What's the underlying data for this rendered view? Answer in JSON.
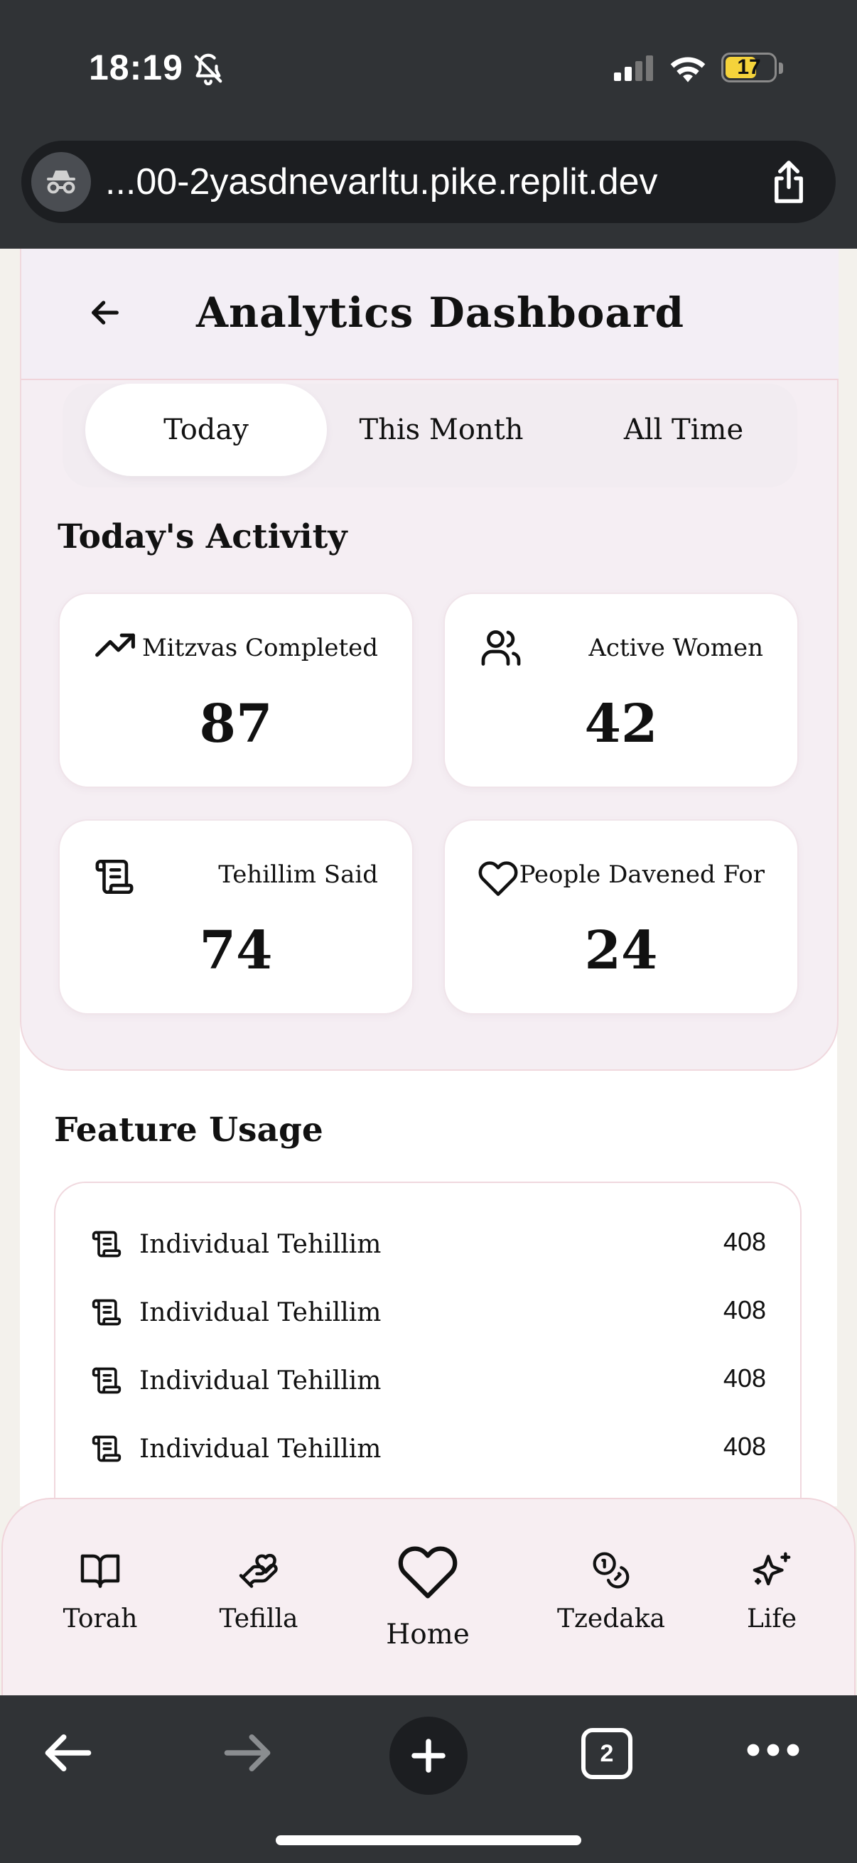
{
  "status_bar": {
    "time": "18:19",
    "battery": "17"
  },
  "browser": {
    "url": "...00-2yasdnevarltu.pike.replit.dev",
    "tab_count": "2"
  },
  "header": {
    "title": "Analytics Dashboard"
  },
  "tabs": [
    {
      "label": "Today",
      "active": true
    },
    {
      "label": "This Month",
      "active": false
    },
    {
      "label": "All Time",
      "active": false
    }
  ],
  "activity": {
    "title": "Today's Activity",
    "cards": [
      {
        "label": "Mitzvas Completed",
        "value": "87",
        "icon": "trending-up-icon"
      },
      {
        "label": "Active Women",
        "value": "42",
        "icon": "users-icon"
      },
      {
        "label": "Tehillim Said",
        "value": "74",
        "icon": "scroll-icon"
      },
      {
        "label": "People Davened For",
        "value": "24",
        "icon": "heart-icon"
      }
    ]
  },
  "feature_usage": {
    "title": "Feature Usage",
    "rows": [
      {
        "name": "Individual Tehillim",
        "count": "408"
      },
      {
        "name": "Individual Tehillim",
        "count": "408"
      },
      {
        "name": "Individual Tehillim",
        "count": "408"
      },
      {
        "name": "Individual Tehillim",
        "count": "408"
      }
    ]
  },
  "bottom_nav": [
    {
      "label": "Torah",
      "icon": "book-icon"
    },
    {
      "label": "Tefilla",
      "icon": "hand-heart-icon"
    },
    {
      "label": "Home",
      "icon": "heart-icon"
    },
    {
      "label": "Tzedaka",
      "icon": "coins-icon"
    },
    {
      "label": "Life",
      "icon": "sparkles-icon"
    }
  ]
}
